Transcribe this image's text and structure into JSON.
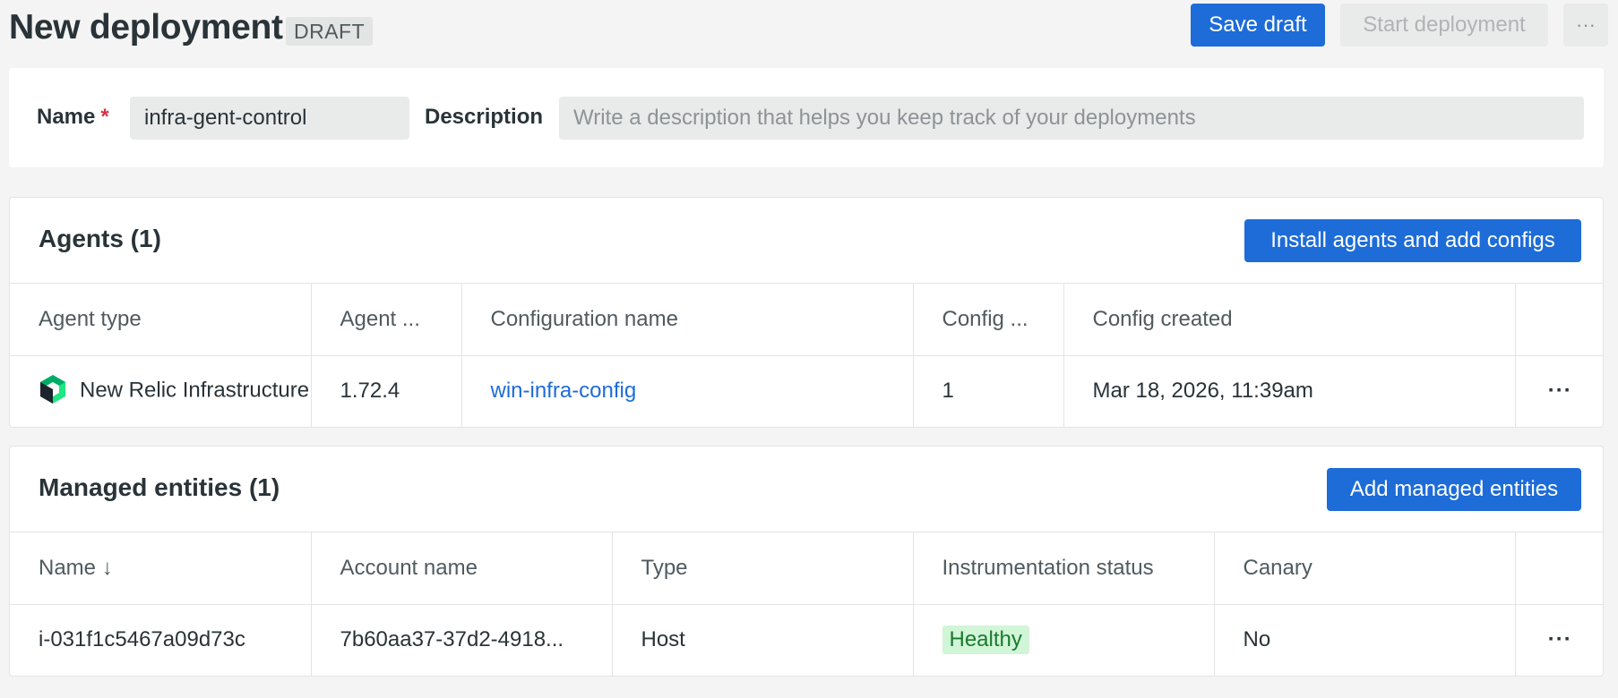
{
  "header": {
    "title": "New deployment",
    "badge": "DRAFT",
    "save_draft": "Save draft",
    "start_deployment": "Start deployment",
    "more": "···"
  },
  "form": {
    "name_label": "Name",
    "required_mark": "*",
    "name_value": "infra-gent-control",
    "description_label": "Description",
    "description_placeholder": "Write a description that helps you keep track of your deployments"
  },
  "agents": {
    "title": "Agents (1)",
    "button": "Install agents and add configs",
    "columns": [
      "Agent type",
      "Agent ...",
      "Configuration name",
      "Config ...",
      "Config created"
    ],
    "rows": [
      {
        "agent_type": "New Relic Infrastructure",
        "agent_version": "1.72.4",
        "config_name": "win-infra-config",
        "config_version": "1",
        "config_created": "Mar 18, 2026, 11:39am",
        "menu": "···"
      }
    ]
  },
  "entities": {
    "title": "Managed entities (1)",
    "button": "Add managed entities",
    "columns": [
      "Name ↓",
      "Account name",
      "Type",
      "Instrumentation status",
      "Canary"
    ],
    "rows": [
      {
        "name": "i-031f1c5467a09d73c",
        "account": "7b60aa37-37d2-4918...",
        "type": "Host",
        "status": "Healthy",
        "canary": "No",
        "menu": "···"
      }
    ]
  },
  "colors": {
    "primary": "#1d6cd8",
    "healthy_bg": "#d1f5d7",
    "healthy_text": "#1b7a2f",
    "required": "#d6324a"
  },
  "icons": {
    "agent_type": "new-relic-logo-icon"
  }
}
